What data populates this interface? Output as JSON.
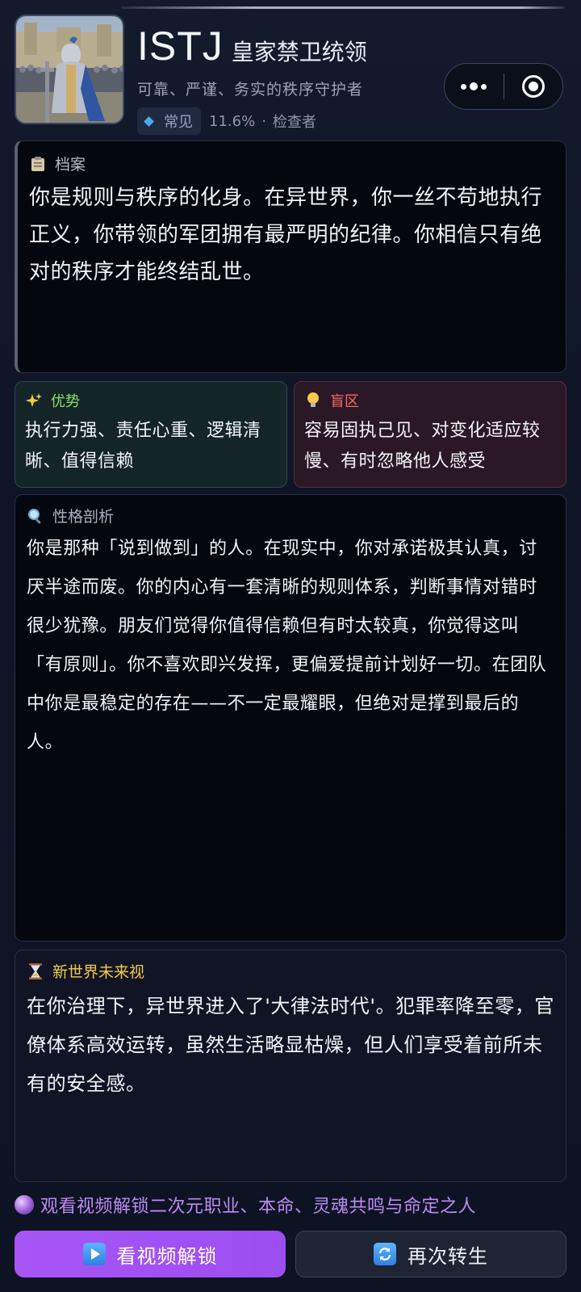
{
  "header": {
    "mbti": "ISTJ",
    "role": "皇家禁卫统领",
    "subtitle": "可靠、严谨、务实的秩序守护者",
    "rarity": "常见",
    "percent": "11.6%",
    "separator": "·",
    "type_name": "检查者",
    "avatar_alt": "armored-knight-portrait"
  },
  "capsule": {
    "more_icon": "more-dots-icon",
    "close_icon": "target-icon"
  },
  "archive": {
    "icon": "clipboard-icon",
    "title": "档案",
    "text": "你是规则与秩序的化身。在异世界，你一丝不苟地执行正义，你带领的军团拥有最严明的纪律。你相信只有绝对的秩序才能终结乱世。"
  },
  "strengths": {
    "icon": "sparkles-icon",
    "title": "优势",
    "text": "执行力强、责任心重、逻辑清晰、值得信赖"
  },
  "blindspots": {
    "icon": "lightbulb-icon",
    "title": "盲区",
    "text": "容易固执己见、对变化适应较慢、有时忽略他人感受"
  },
  "analysis": {
    "icon": "magnifier-icon",
    "title": "性格剖析",
    "text": "你是那种「说到做到」的人。在现实中，你对承诺极其认真，讨厌半途而废。你的内心有一套清晰的规则体系，判断事情对错时很少犹豫。朋友们觉得你值得信赖但有时太较真，你觉得这叫「有原则」。你不喜欢即兴发挥，更偏爱提前计划好一切。在团队中你是最稳定的存在——不一定最耀眼，但绝对是撑到最后的人。"
  },
  "future": {
    "icon": "hourglass-icon",
    "title": "新世界未来视",
    "text": "在你治理下，异世界进入了'大律法时代'。犯罪率降至零，官僚体系高效运转，虽然生活略显枯燥，但人们享受着前所未有的安全感。"
  },
  "unlock_hint": {
    "icon": "crystal-ball-icon",
    "text": "观看视频解锁二次元职业、本命、灵魂共鸣与命定之人"
  },
  "buttons": {
    "watch_label": "看视频解锁",
    "rebirth_label": "再次转生"
  },
  "colors": {
    "accent_purple": "#a855f7",
    "strength_green": "#8ee06c",
    "blindspot_red": "#ff6a6a",
    "future_gold": "#f2c94c"
  }
}
